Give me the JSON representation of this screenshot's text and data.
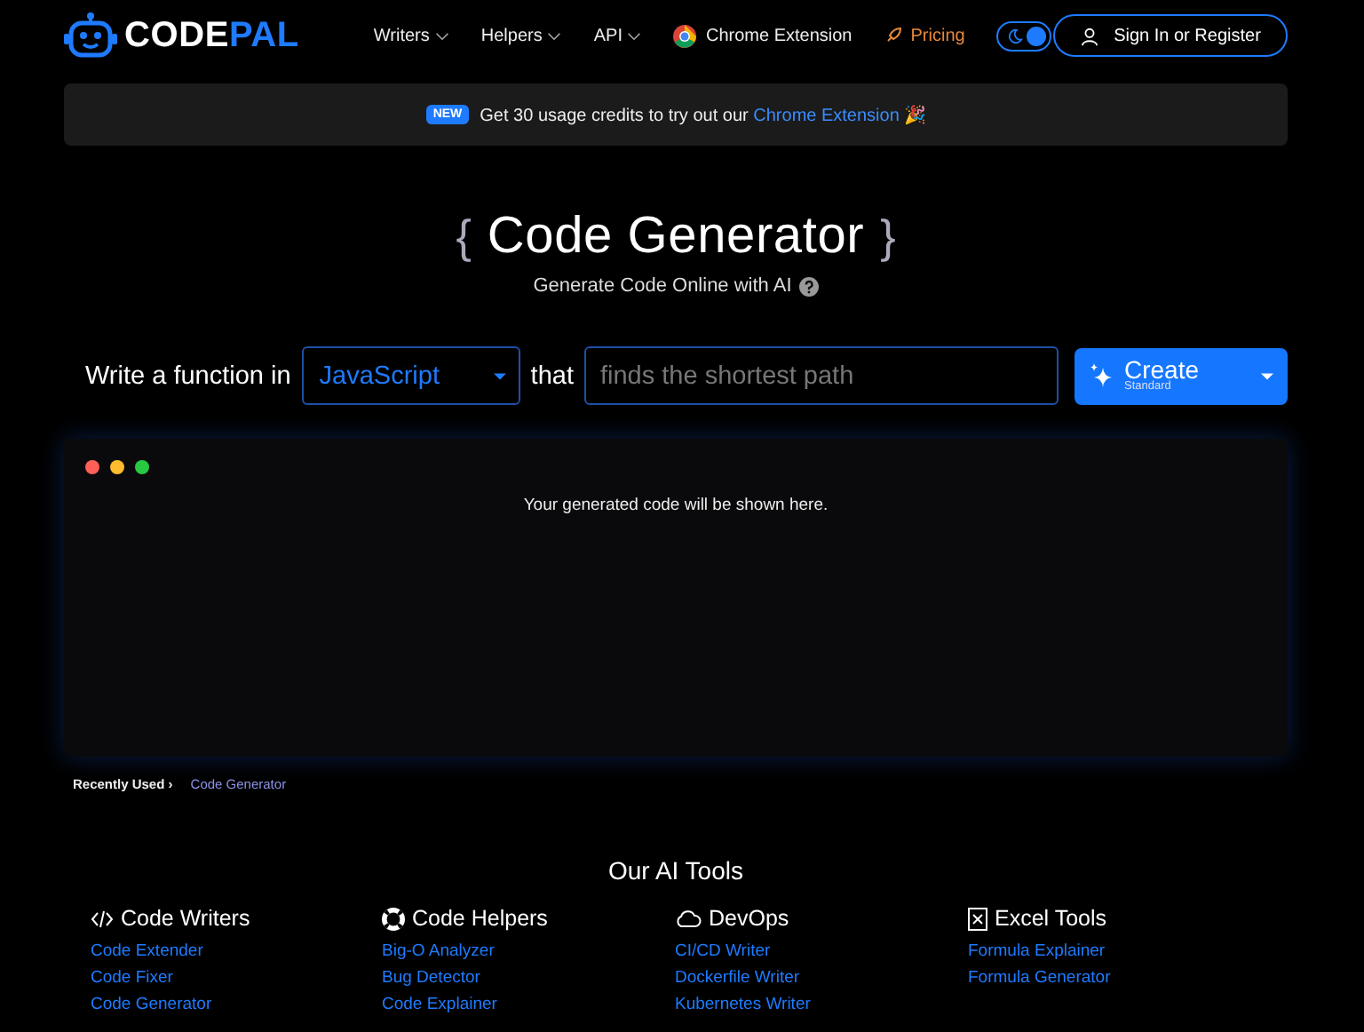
{
  "header": {
    "logo": {
      "part_1": "CODE",
      "part_2": "PAL"
    },
    "nav": [
      {
        "kind": "dropdown",
        "label": "Writers"
      },
      {
        "kind": "dropdown",
        "label": "Helpers"
      },
      {
        "kind": "dropdown",
        "label": "API"
      },
      {
        "kind": "chrome",
        "label": "Chrome Extension"
      },
      {
        "kind": "pricing",
        "label": "Pricing"
      }
    ],
    "dark_mode": {
      "on": true
    },
    "sign_in": "Sign In or Register"
  },
  "banner": {
    "badge": "NEW",
    "text": "Get 30 usage credits to try out our",
    "link": "Chrome Extension",
    "emoji": "🎉"
  },
  "title": {
    "open": "{",
    "text": "Code Generator",
    "close": "}"
  },
  "subtitle": "Generate Code Online with AI",
  "prompt": {
    "prefix": "Write a function in",
    "language": "JavaScript",
    "middle": "that",
    "placeholder": "finds the shortest path",
    "create": "Create",
    "create_mode": "Standard"
  },
  "output": {
    "message": "Your generated code will be shown here."
  },
  "recently_used": {
    "label": "Recently Used ›",
    "items": [
      "Code Generator"
    ]
  },
  "tools": {
    "title": "Our AI Tools",
    "columns": [
      {
        "kind": "code",
        "title": "Code Writers",
        "links": [
          "Code Extender",
          "Code Fixer",
          "Code Generator"
        ]
      },
      {
        "kind": "helpers",
        "title": "Code Helpers",
        "links": [
          "Big-O Analyzer",
          "Bug Detector",
          "Code Explainer"
        ]
      },
      {
        "kind": "cloud",
        "title": "DevOps",
        "links": [
          "CI/CD Writer",
          "Dockerfile Writer",
          "Kubernetes Writer"
        ]
      },
      {
        "kind": "excel",
        "title": "Excel Tools",
        "links": [
          "Formula Explainer",
          "Formula Generator"
        ]
      }
    ]
  }
}
